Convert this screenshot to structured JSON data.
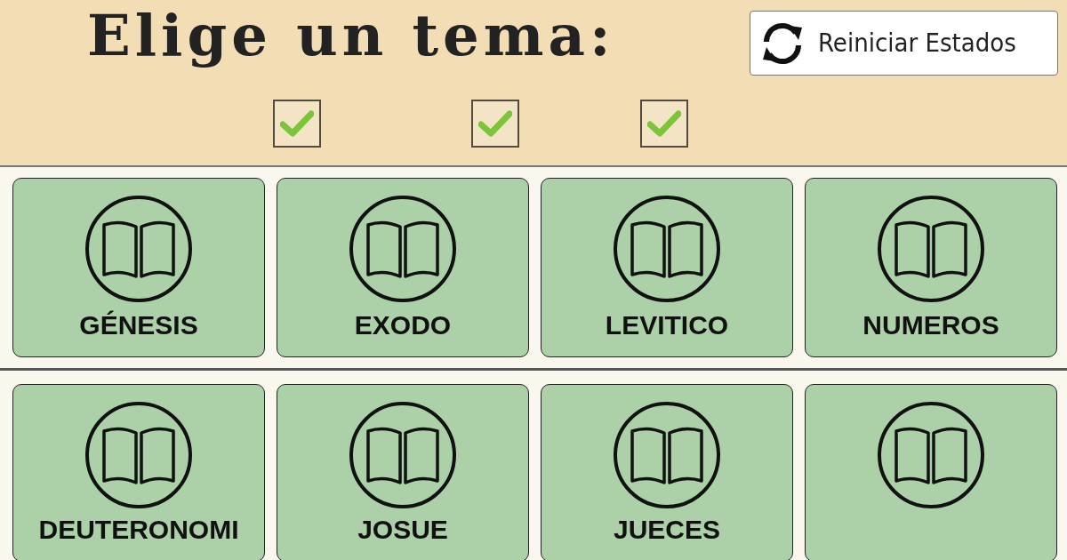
{
  "header": {
    "title": "Elige un tema:",
    "reset_button": "Reiniciar Estados",
    "checkboxes": [
      {
        "checked": true
      },
      {
        "checked": true
      },
      {
        "checked": true
      }
    ]
  },
  "rows": [
    {
      "cards": [
        {
          "kind": "book",
          "label": "GÉNESIS"
        },
        {
          "kind": "book",
          "label": "EXODO"
        },
        {
          "kind": "book",
          "label": "LEVITICO"
        },
        {
          "kind": "book",
          "label": "NUMEROS"
        }
      ]
    },
    {
      "cards": [
        {
          "kind": "book",
          "label": "DEUTERONOMI"
        },
        {
          "kind": "book",
          "label": "JOSUE"
        },
        {
          "kind": "book",
          "label": "JUECES"
        },
        {
          "kind": "book"
        }
      ]
    }
  ]
}
